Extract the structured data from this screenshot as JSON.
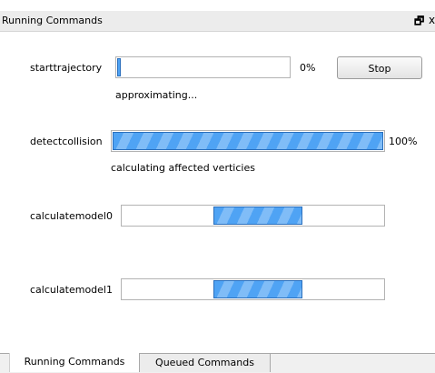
{
  "panel": {
    "title": "Running Commands",
    "float_icon": "restore-float-icon",
    "close_icon": "close-icon",
    "float_glyph": "🗗",
    "close_glyph": "x"
  },
  "commands": [
    {
      "name": "starttrajectory",
      "progress_percent": 2,
      "percent_label": "0%",
      "status": "approximating...",
      "stop_label": "Stop"
    },
    {
      "name": "detectcollision",
      "progress_percent": 100,
      "percent_label": "100%",
      "status": "calculating affected verticies"
    },
    {
      "name": "calculatemodel0",
      "indeterminate": true,
      "busy_segment_start": 0.35,
      "busy_segment_end": 0.69
    },
    {
      "name": "calculatemodel1",
      "indeterminate": true,
      "busy_segment_start": 0.35,
      "busy_segment_end": 0.69
    }
  ],
  "tabs": [
    {
      "label": "Running Commands",
      "selected": true
    },
    {
      "label": "Queued Commands",
      "selected": false
    }
  ],
  "colors": {
    "progress_fill": "#4fa3f4",
    "progress_border": "#2a6fbd",
    "titlebar": "#ececec"
  }
}
